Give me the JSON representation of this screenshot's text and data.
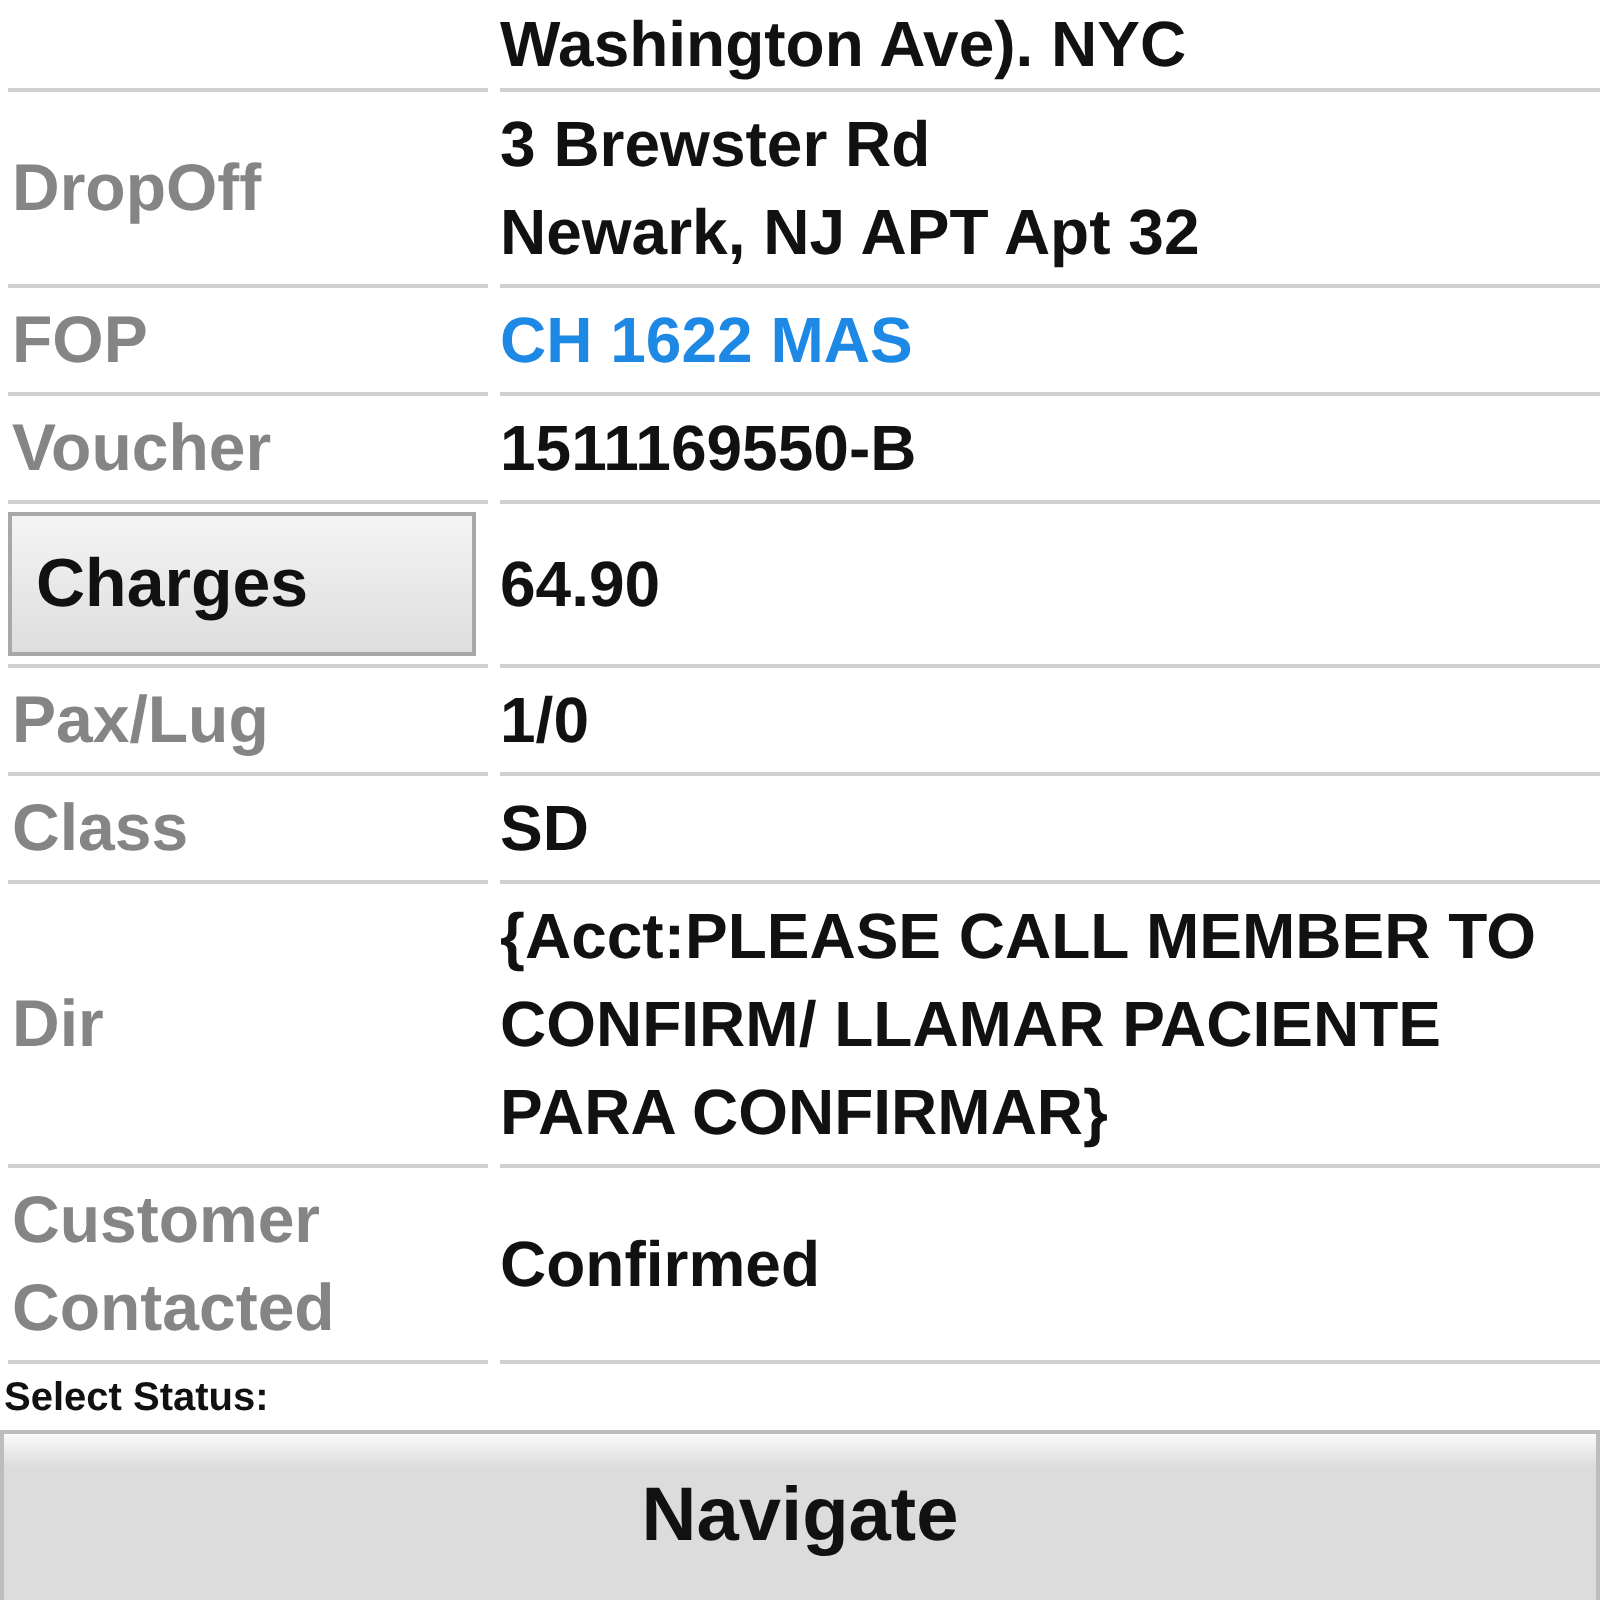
{
  "rows": [
    {
      "kind": "plain",
      "label": "",
      "value": "Washington Ave). NYC"
    },
    {
      "kind": "plain",
      "label": "DropOff",
      "value": "3 Brewster Rd\nNewark, NJ APT Apt 32"
    },
    {
      "kind": "link",
      "label": "FOP",
      "value": "CH 1622 MAS"
    },
    {
      "kind": "plain",
      "label": "Voucher",
      "value": "1511169550-B"
    },
    {
      "kind": "button",
      "label": "Charges",
      "value": "64.90"
    },
    {
      "kind": "plain",
      "label": "Pax/Lug",
      "value": "1/0"
    },
    {
      "kind": "plain",
      "label": "Class",
      "value": "SD"
    },
    {
      "kind": "plain",
      "label": "Dir",
      "value": "{Acct:PLEASE CALL MEMBER TO CONFIRM/ LLAMAR PACIENTE PARA CONFIRMAR}"
    },
    {
      "kind": "plain",
      "label": "Customer Contacted",
      "value": "Confirmed"
    }
  ],
  "status_label": "Select Status:",
  "navigate_button": "Navigate"
}
